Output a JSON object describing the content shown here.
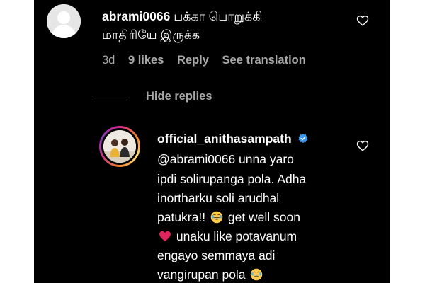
{
  "comment": {
    "username": "abrami0066",
    "text_line1": "பக்கா பொறுக்கி",
    "text_line2": "மாதிரியே இருக்க",
    "meta": {
      "time": "3d",
      "likes": "9 likes",
      "reply": "Reply",
      "see_translation": "See translation"
    },
    "like_icon": "heart-outline-icon"
  },
  "replies_toggle": {
    "label": "Hide replies"
  },
  "reply": {
    "username": "official_anithasampath",
    "verified_icon": "verified-badge-icon",
    "lines": [
      "@abrami0066 unna yaro",
      "ipdi solirupanga pola. Adha",
      "inortharku soli arudhal",
      "patukra!!",
      "get well soon",
      "unaku like potavanum",
      "engayo semmaya adi",
      "vangirupan pola"
    ],
    "emojis": [
      "😂",
      "❤️",
      "😂"
    ],
    "like_icon": "heart-outline-icon"
  },
  "colors": {
    "background": "#000000",
    "text": "#ffffff",
    "secondary_text": "#a8a8a8",
    "verified": "#3897f0",
    "heart_red": "#e0245e"
  }
}
